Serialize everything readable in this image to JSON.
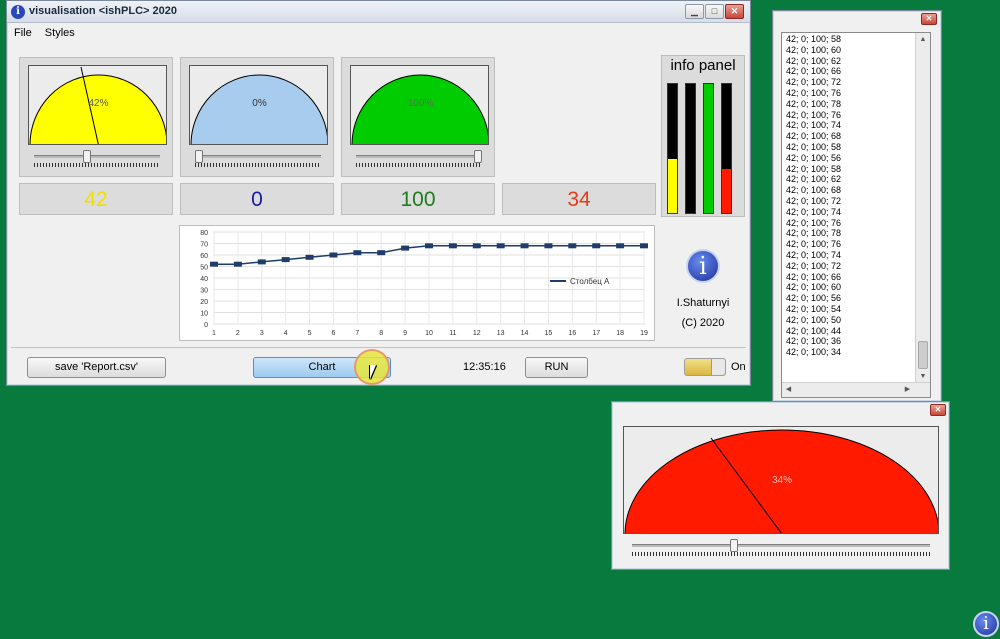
{
  "main_window": {
    "title": "visualisation <ishPLC> 2020",
    "icon_glyph": "i",
    "controls": {
      "minimize": "▁",
      "maximize": "□",
      "close": "✕"
    },
    "menu": [
      "File",
      "Styles"
    ],
    "gauges": [
      {
        "label": "42%",
        "percent": 42,
        "color": "#ffff00",
        "value": "42",
        "value_color": "#f0e000"
      },
      {
        "label": "0%",
        "percent": 0,
        "color": "#a8ccee",
        "value": "0",
        "value_color": "#1a1aa8"
      },
      {
        "label": "100%",
        "percent": 100,
        "color": "#00cc00",
        "value": "100",
        "value_color": "#1e7d1e"
      },
      {
        "value": "34",
        "value_color": "#e83a1a"
      }
    ],
    "info_panel": {
      "title": "info panel",
      "bars": [
        {
          "level": 0.42,
          "color": "#ffff00"
        },
        {
          "level": 0,
          "color": "#a8ccee"
        },
        {
          "level": 1,
          "color": "#00cc00"
        },
        {
          "level": 0.34,
          "color": "#ff1a00"
        }
      ]
    },
    "author": {
      "icon_glyph": "i",
      "name": "I.Shaturnyi",
      "copyright": "(C) 2020"
    },
    "bottom": {
      "save_label": "save 'Report.csv'",
      "chart_label": "Chart",
      "time": "12:35:16",
      "run_label": "RUN",
      "toggle_label": "On"
    }
  },
  "chart_data": {
    "type": "line",
    "x": [
      1,
      2,
      3,
      4,
      5,
      6,
      7,
      8,
      9,
      10,
      11,
      12,
      13,
      14,
      15,
      16,
      17,
      18,
      19
    ],
    "series": [
      {
        "name": "Столбец A",
        "values": [
          52,
          52,
          54,
          56,
          58,
          60,
          62,
          62,
          66,
          68,
          68,
          68,
          68,
          68,
          68,
          68,
          68,
          68,
          68
        ],
        "color": "#1f3d6a"
      }
    ],
    "ylim": [
      0,
      80
    ],
    "yticks": [
      0,
      10,
      20,
      30,
      40,
      50,
      60,
      70,
      80
    ],
    "legend_position": "right",
    "grid": true
  },
  "log_window": {
    "close": "✕",
    "lines": [
      "42; 0; 100; 58",
      "42; 0; 100; 60",
      "42; 0; 100; 62",
      "42; 0; 100; 66",
      "42; 0; 100; 72",
      "42; 0; 100; 76",
      "42; 0; 100; 78",
      "42; 0; 100; 76",
      "42; 0; 100; 74",
      "42; 0; 100; 68",
      "42; 0; 100; 58",
      "42; 0; 100; 56",
      "42; 0; 100; 58",
      "42; 0; 100; 62",
      "42; 0; 100; 68",
      "42; 0; 100; 72",
      "42; 0; 100; 74",
      "42; 0; 100; 76",
      "42; 0; 100; 78",
      "42; 0; 100; 76",
      "42; 0; 100; 74",
      "42; 0; 100; 72",
      "42; 0; 100; 66",
      "42; 0; 100; 60",
      "42; 0; 100; 56",
      "42; 0; 100; 54",
      "42; 0; 100; 50",
      "42; 0; 100; 44",
      "42; 0; 100; 36",
      "42; 0; 100; 34"
    ],
    "scroll": {
      "up": "▲",
      "down": "▼",
      "left": "◀",
      "right": "▶"
    }
  },
  "big_gauge_window": {
    "close": "✕",
    "label": "34%",
    "percent": 34,
    "color": "#ff1a00"
  },
  "desktop_icon_glyph": "i"
}
